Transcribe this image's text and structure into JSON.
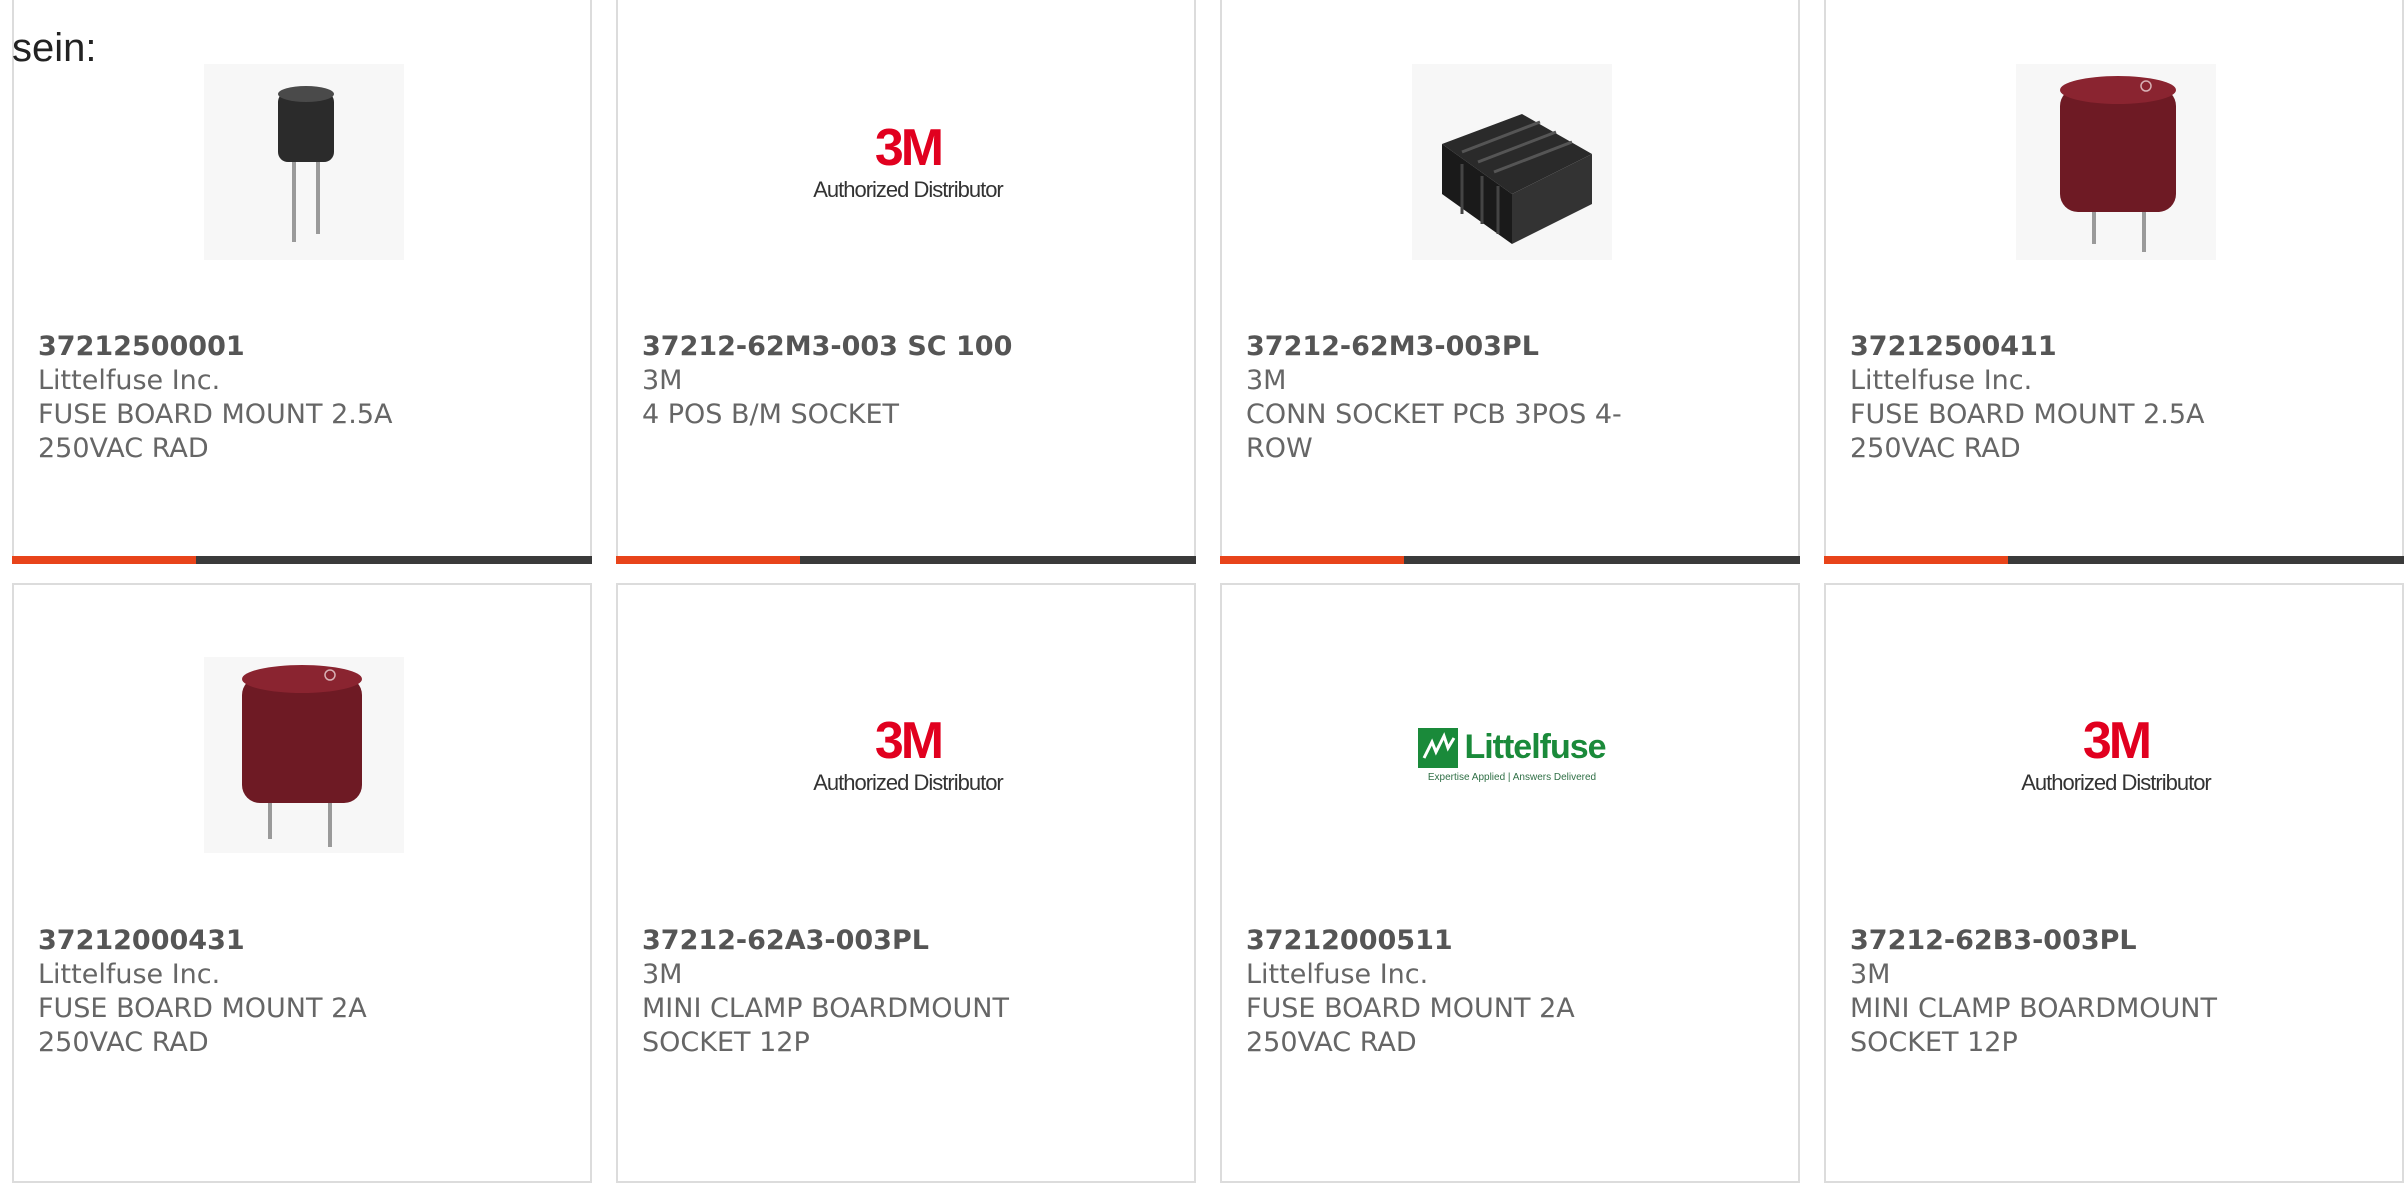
{
  "intro_text": "sein:",
  "colors": {
    "accent": "#e8441a",
    "bar": "#3a3a3a",
    "border": "#dcdcdc"
  },
  "products": [
    {
      "part": "37212500001",
      "mfr": "Littelfuse Inc.",
      "desc": "FUSE BOARD MOUNT 2.5A 250VAC RAD",
      "image": "black-fuse"
    },
    {
      "part": "37212-62M3-003 SC 100",
      "mfr": "3M",
      "desc": "4 POS B/M SOCKET",
      "image": "3m-logo",
      "logo_mark": "3M",
      "logo_sub": "Authorized Distributor"
    },
    {
      "part": "37212-62M3-003PL",
      "mfr": "3M",
      "desc": "CONN SOCKET PCB 3POS 4-ROW",
      "image": "black-socket"
    },
    {
      "part": "37212500411",
      "mfr": "Littelfuse Inc.",
      "desc": "FUSE BOARD MOUNT 2.5A 250VAC RAD",
      "image": "red-fuse"
    },
    {
      "part": "37212000431",
      "mfr": "Littelfuse Inc.",
      "desc": "FUSE BOARD MOUNT 2A 250VAC RAD",
      "image": "red-fuse"
    },
    {
      "part": "37212-62A3-003PL",
      "mfr": "3M",
      "desc": "MINI CLAMP BOARDMOUNT SOCKET 12P",
      "image": "3m-logo",
      "logo_mark": "3M",
      "logo_sub": "Authorized Distributor"
    },
    {
      "part": "37212000511",
      "mfr": "Littelfuse Inc.",
      "desc": "FUSE BOARD MOUNT 2A 250VAC RAD",
      "image": "littelfuse-logo",
      "logo_word": "Littelfuse",
      "logo_tag": "Expertise Applied | Answers Delivered"
    },
    {
      "part": "37212-62B3-003PL",
      "mfr": "3M",
      "desc": "MINI CLAMP BOARDMOUNT SOCKET 12P",
      "image": "3m-logo",
      "logo_mark": "3M",
      "logo_sub": "Authorized Distributor"
    }
  ]
}
